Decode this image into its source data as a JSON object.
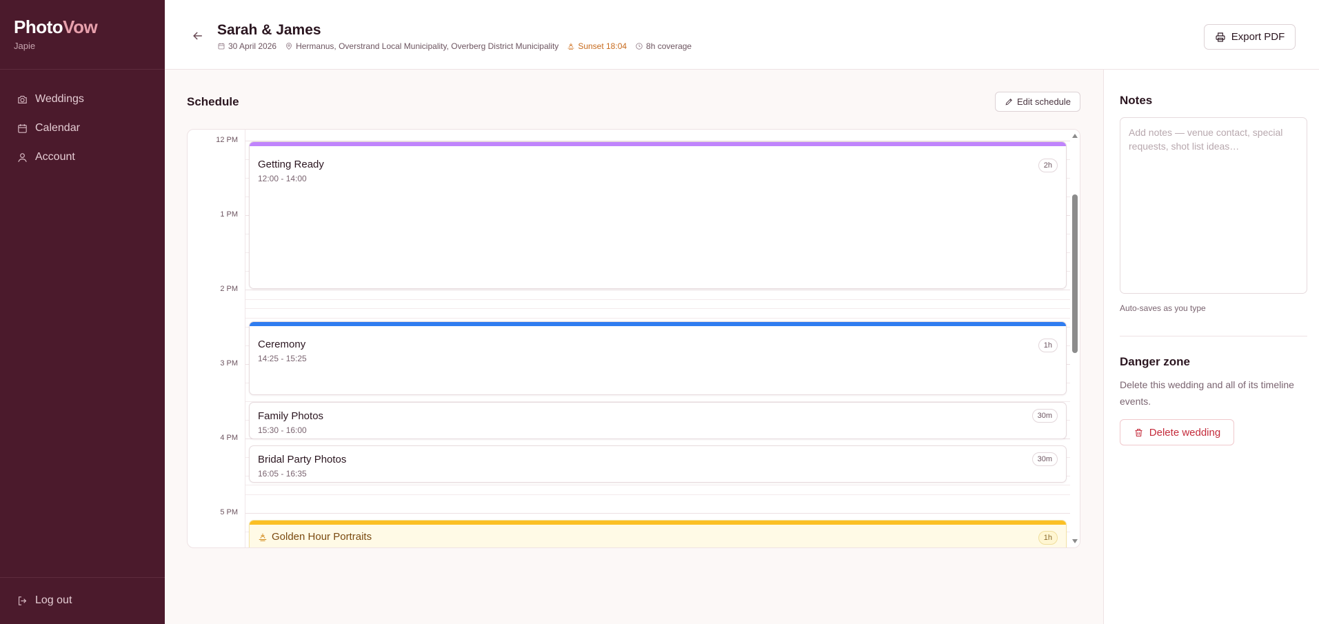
{
  "brand": {
    "part1": "Photo",
    "part2": "Vow",
    "user": "Japie"
  },
  "nav": {
    "items": [
      {
        "label": "Weddings",
        "icon": "camera-icon"
      },
      {
        "label": "Calendar",
        "icon": "calendar-icon"
      },
      {
        "label": "Account",
        "icon": "user-icon"
      }
    ],
    "logout_label": "Log out"
  },
  "header": {
    "title": "Sarah & James",
    "date": "30 April 2026",
    "location": "Hermanus, Overstrand Local Municipality, Overberg District Municipality",
    "sunset": "Sunset 18:04",
    "coverage": "8h coverage",
    "export_label": "Export PDF"
  },
  "schedule": {
    "title": "Schedule",
    "edit_label": "Edit schedule",
    "hours": [
      "12 PM",
      "1 PM",
      "2 PM",
      "3 PM",
      "4 PM",
      "5 PM"
    ],
    "events": [
      {
        "name": "Getting Ready",
        "time": "12:00 - 14:00",
        "duration": "2h",
        "color": "#c084fc"
      },
      {
        "name": "Ceremony",
        "time": "14:25 - 15:25",
        "duration": "1h",
        "color": "#2f7df0"
      },
      {
        "name": "Family Photos",
        "time": "15:30 - 16:00",
        "duration": "30m",
        "color": null
      },
      {
        "name": "Bridal Party Photos",
        "time": "16:05 - 16:35",
        "duration": "30m",
        "color": null
      },
      {
        "name": "Golden Hour Portraits",
        "time": "",
        "duration": "1h",
        "color": "#fbbf24"
      }
    ]
  },
  "notes": {
    "title": "Notes",
    "placeholder": "Add notes — venue contact, special requests, shot list ideas…",
    "value": "",
    "autosave": "Auto-saves as you type"
  },
  "danger": {
    "title": "Danger zone",
    "description": "Delete this wedding and all of its timeline events.",
    "delete_label": "Delete wedding"
  },
  "colors": {
    "sidebar_bg": "#4b1a2c",
    "accent": "#e7a0ac",
    "danger": "#c42b3b",
    "sunset": "#c76a1c"
  }
}
